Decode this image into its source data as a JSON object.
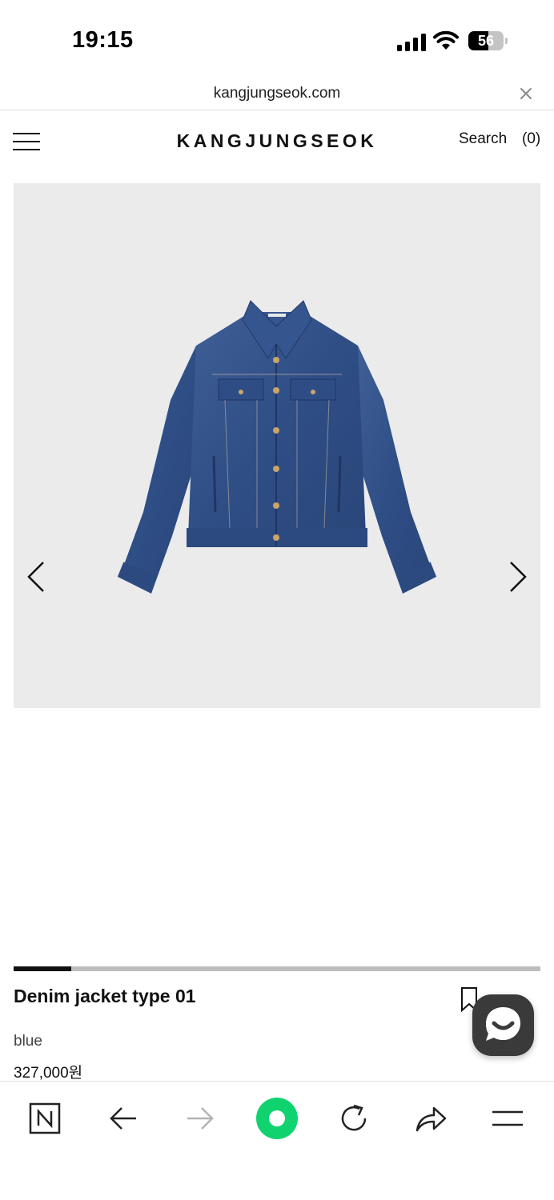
{
  "status_bar": {
    "time": "19:15",
    "battery": "56",
    "battery_level": 0.56
  },
  "url_bar": {
    "url": "kangjungseok.com"
  },
  "header": {
    "brand": "KANGJUNGSEOK",
    "search_label": "Search",
    "cart_label": "(0)"
  },
  "gallery": {
    "image": "denim-jacket-photo",
    "progress": 0.11
  },
  "product": {
    "name": "Denim jacket type 01",
    "color": "blue",
    "price": "327,000원"
  },
  "toolbar": {
    "home_color": "#10d36f"
  }
}
